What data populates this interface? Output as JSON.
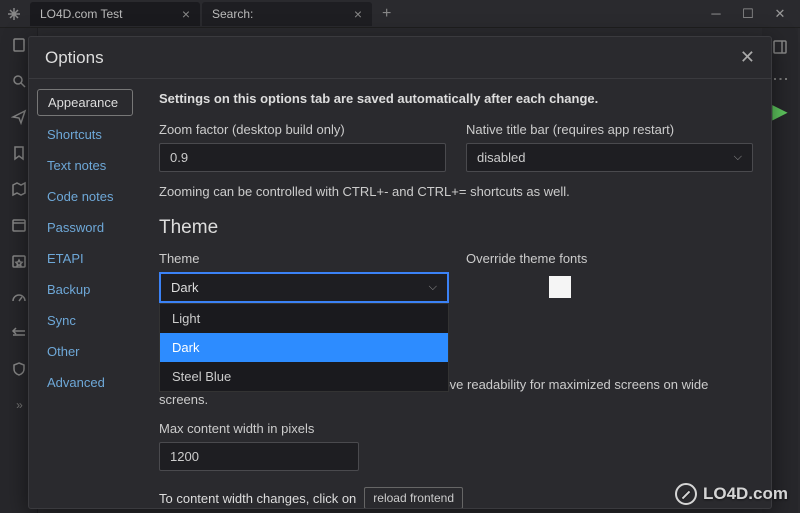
{
  "tabs": [
    {
      "title": "LO4D.com Test",
      "active": true
    },
    {
      "title": "Search:",
      "active": false
    }
  ],
  "modal": {
    "title": "Options",
    "nav": [
      "Appearance",
      "Shortcuts",
      "Text notes",
      "Code notes",
      "Password",
      "ETAPI",
      "Backup",
      "Sync",
      "Other",
      "Advanced"
    ],
    "activeNavIndex": 0,
    "infoLine": "Settings on this options tab are saved automatically after each change.",
    "zoom": {
      "label": "Zoom factor (desktop build only)",
      "value": "0.9",
      "hint": "Zooming can be controlled with CTRL+- and CTRL+= shortcuts as well."
    },
    "titlebar": {
      "label": "Native title bar (requires app restart)",
      "value": "disabled"
    },
    "themeSection": {
      "heading": "Theme",
      "themeLabel": "Theme",
      "themeValue": "Dark",
      "options": [
        "Light",
        "Dark",
        "Steel Blue"
      ],
      "selectedOption": "Dark",
      "overrideLabel": "Override theme fonts",
      "overrideChecked": false
    },
    "coveredText": "Trilium by default limits max content width to improve readability for maximized screens on wide screens.",
    "maxWidth": {
      "label": "Max content width in pixels",
      "value": "1200"
    },
    "reload": {
      "prefix": "To content width changes, click on",
      "button": "reload frontend"
    }
  },
  "watermark": "LO4D.com"
}
